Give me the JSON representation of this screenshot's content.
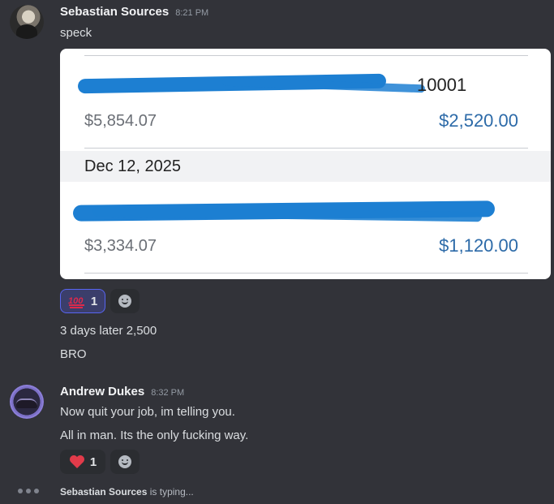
{
  "messages": [
    {
      "author": "Sebastian Sources",
      "time": "8:21 PM",
      "lines": [
        "speck"
      ],
      "attachment": {
        "rows": [
          {
            "account_tail": "10001",
            "balance": "$5,854.07",
            "amount": "$2,520.00"
          },
          {
            "date": "Dec 12, 2025",
            "account_tail": "",
            "balance": "$3,334.07",
            "amount": "$1,120.00"
          }
        ]
      },
      "reactions": [
        {
          "emoji": "100",
          "count": "1",
          "active": true
        }
      ],
      "followups": [
        "3 days later 2,500",
        "BRO"
      ]
    },
    {
      "author": "Andrew Dukes",
      "time": "8:32 PM",
      "lines": [
        "Now quit your job, im telling you.",
        "All in man. Its the only fucking way."
      ],
      "reactions": [
        {
          "emoji": "heart",
          "count": "1",
          "active": false
        }
      ]
    }
  ],
  "typing": {
    "user": "Sebastian Sources",
    "suffix": "is typing..."
  },
  "colors": {
    "background": "#323339",
    "accent": "#5865f2",
    "amount_blue": "#2c6aa8",
    "heart": "#e23b4a",
    "hundred_red": "#e0294b"
  }
}
